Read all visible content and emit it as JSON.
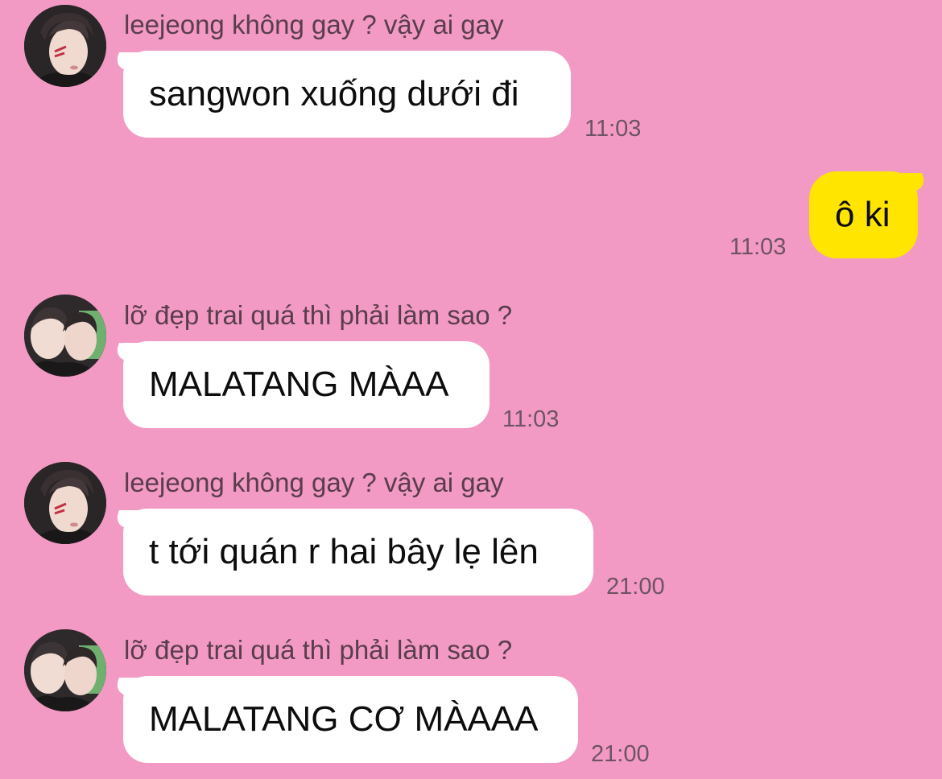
{
  "chat": {
    "messages": [
      {
        "sender": "leejeong không gay ? vậy ai gay",
        "text": "sangwon xuống dưới đi",
        "time": "11:03",
        "direction": "incoming",
        "avatar": "avatar-single-person"
      },
      {
        "text": "ô ki",
        "time": "11:03",
        "direction": "outgoing"
      },
      {
        "sender": "lỡ đẹp trai quá thì phải làm sao ?",
        "text": "MALATANG MÀAA",
        "time": "11:03",
        "direction": "incoming",
        "avatar": "avatar-two-people"
      },
      {
        "sender": "leejeong không gay ? vậy ai gay",
        "text": "t tới quán r hai bây lẹ lên",
        "time": "21:00",
        "direction": "incoming",
        "avatar": "avatar-single-person"
      },
      {
        "sender": "lỡ đẹp trai quá thì phải làm sao ?",
        "text": "MALATANG CƠ MÀAAA",
        "time": "21:00",
        "direction": "incoming",
        "avatar": "avatar-two-people"
      }
    ]
  },
  "colors": {
    "background": "#f29ac4",
    "incoming_bubble": "#ffffff",
    "outgoing_bubble": "#ffe500",
    "sender_text": "#5a3d4c",
    "timestamp_text": "#6e5363"
  }
}
